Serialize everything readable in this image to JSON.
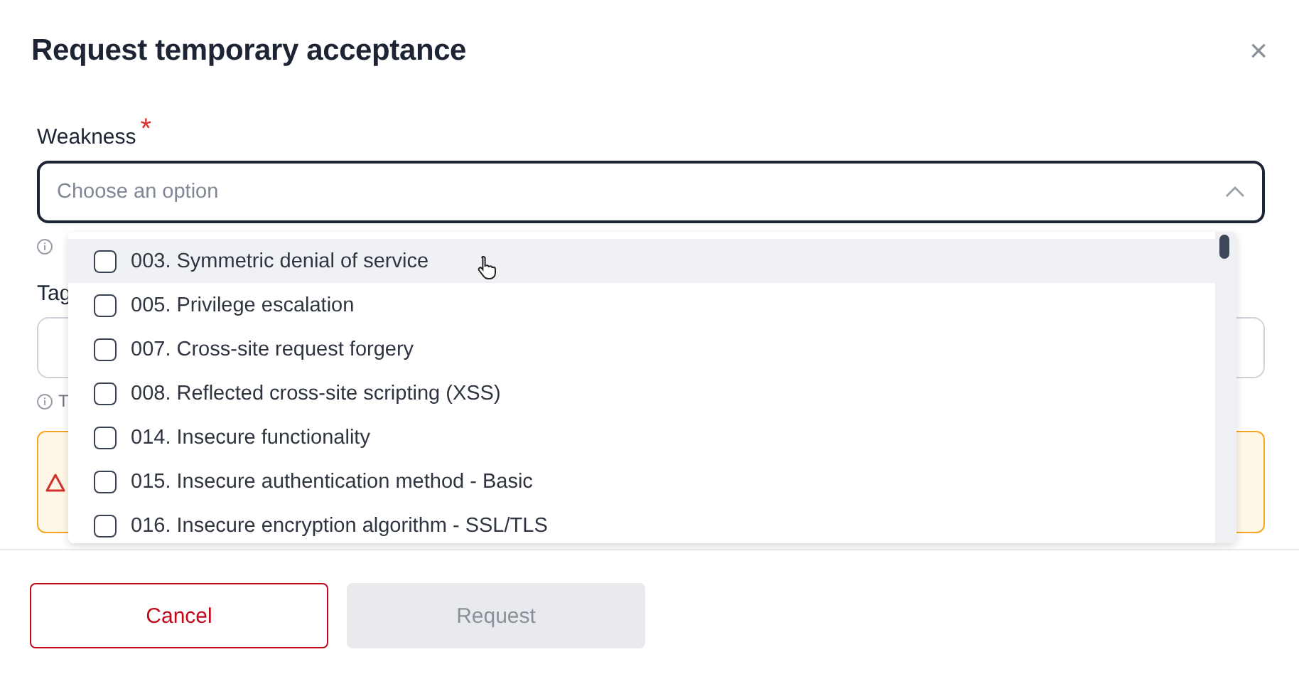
{
  "dialog": {
    "title": "Request temporary acceptance",
    "close": "×"
  },
  "weakness": {
    "label": "Weakness",
    "required_mark": "*",
    "placeholder": "Choose an option",
    "expanded": true,
    "options": [
      {
        "label": "003. Symmetric denial of service",
        "checked": false,
        "highlighted": true
      },
      {
        "label": "005. Privilege escalation",
        "checked": false,
        "highlighted": false
      },
      {
        "label": "007. Cross-site request forgery",
        "checked": false,
        "highlighted": false
      },
      {
        "label": "008. Reflected cross-site scripting (XSS)",
        "checked": false,
        "highlighted": false
      },
      {
        "label": "014. Insecure functionality",
        "checked": false,
        "highlighted": false
      },
      {
        "label": "015. Insecure authentication method - Basic",
        "checked": false,
        "highlighted": false
      },
      {
        "label": "016. Insecure encryption algorithm - SSL/TLS",
        "checked": false,
        "highlighted": false
      }
    ]
  },
  "tags": {
    "label": "Tag",
    "hint": "T"
  },
  "warning": {
    "kind": "warning"
  },
  "buttons": [
    {
      "label": "Cancel",
      "disabled": false,
      "kind": "outline"
    },
    {
      "label": "Request",
      "disabled": true,
      "kind": "primary"
    }
  ]
}
